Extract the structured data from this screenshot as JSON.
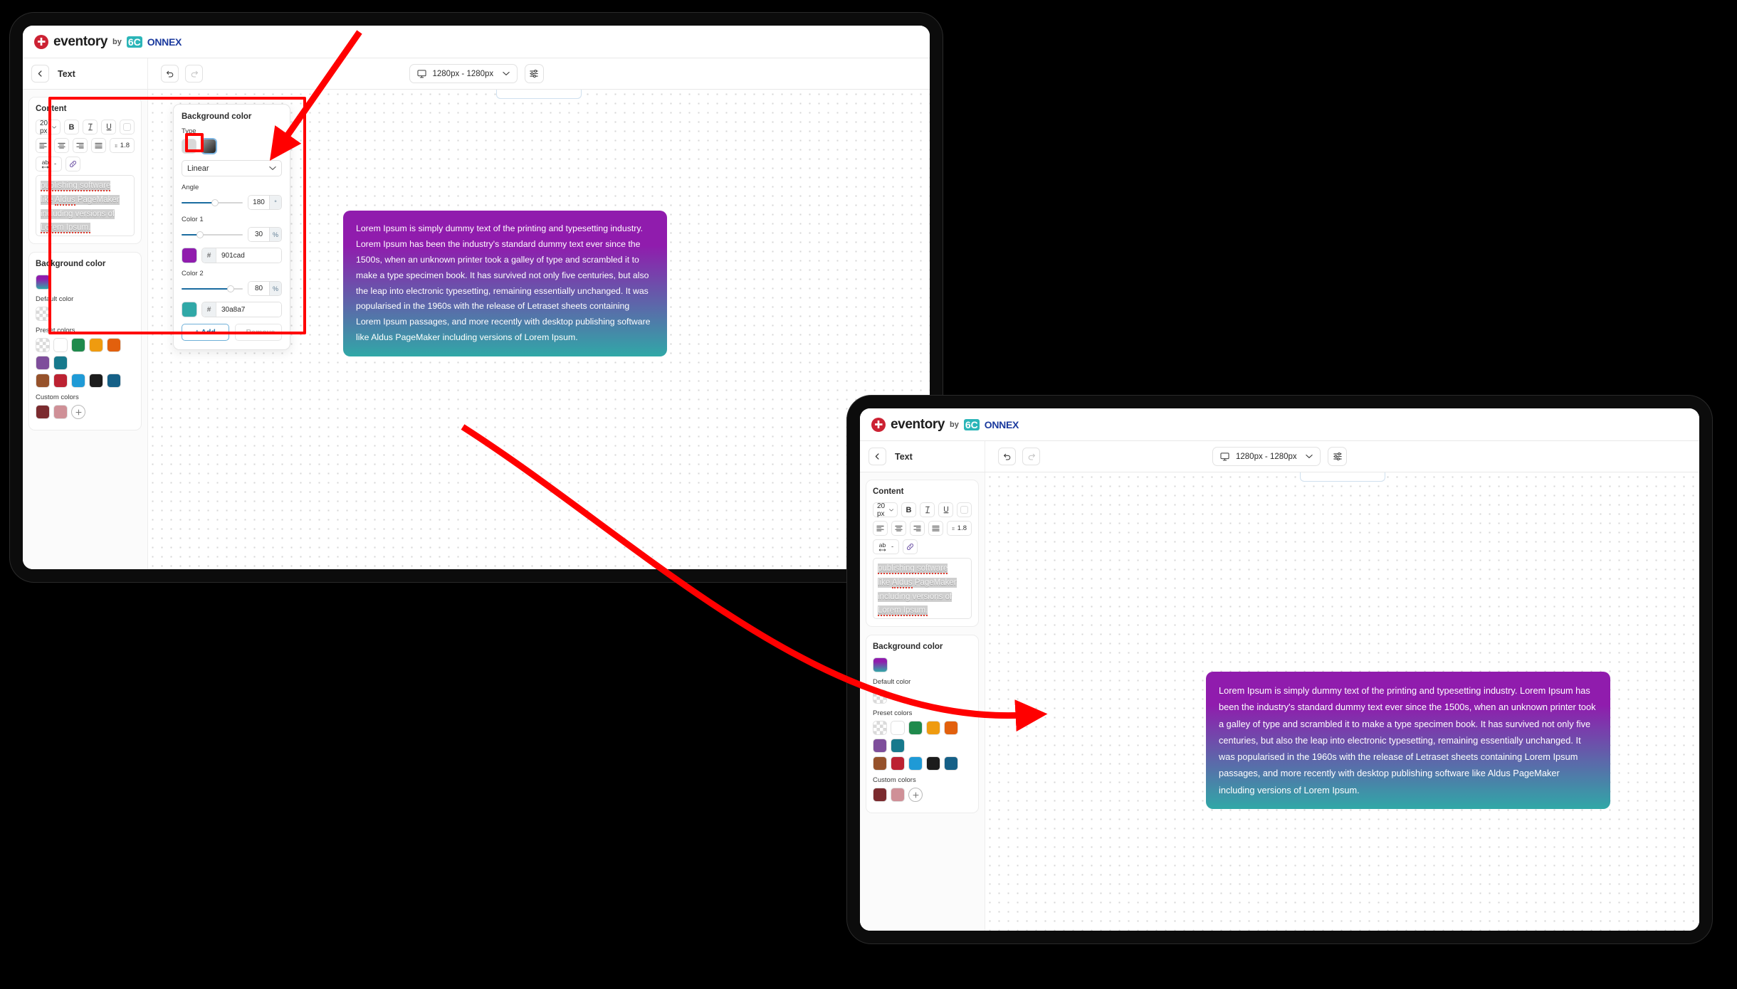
{
  "brand": {
    "name": "eventory",
    "by": "by",
    "partner_prefix": "6C",
    "partner_suffix": "ONNEX",
    "mark_color": "#cc2233",
    "partner_badge_color": "#2bb5b8",
    "partner_text_color": "#1b3a9e"
  },
  "toolbar": {
    "back_label": "‹",
    "title": "Text",
    "undo_icon": "undo-icon",
    "redo_icon": "redo-icon",
    "device_icon": "monitor-icon",
    "device_value": "1280px - 1280px",
    "chevron": "⌄",
    "settings_icon": "sliders-icon"
  },
  "content_card": {
    "title": "Content",
    "font_size": "20 px",
    "bold_label": "B",
    "italic_label": "I",
    "underline_label": "U",
    "color_label": "text-color-swatch",
    "align_left": "align-left-icon",
    "align_center": "align-center-icon",
    "align_right": "align-right-icon",
    "align_justify": "align-justify-icon",
    "line_height_icon": "line-height-icon",
    "line_height_value": "1.8",
    "letter_spacing_icon": "ab",
    "letter_spacing_value": "-",
    "link_icon": "link-icon",
    "preview_lines": [
      "publishing software",
      "like Aldus PageMaker",
      "including versions of",
      "Lorem Ipsum."
    ]
  },
  "background_card": {
    "title": "Background color",
    "current_gradient": "linear-gradient(#901cad, #30a8a7)",
    "default_label": "Default color",
    "default_value": "transparent",
    "preset_label": "Preset colors",
    "preset_colors": [
      "transparent",
      "#ffffff",
      "#1f8a4c",
      "#ef9b0f",
      "#e2600d",
      "#7e4e9b",
      "#17798c",
      "#96522b",
      "#bc2232",
      "#1f9ad6",
      "#1c1c1c",
      "#156087"
    ],
    "custom_label": "Custom colors",
    "custom_colors": [
      "#7b2b2f",
      "#cf9097"
    ],
    "add_custom_label": "+"
  },
  "gradient_popup": {
    "title": "Background color",
    "type_label": "Type",
    "type_solid": "solid-swatch",
    "type_gradient": "gradient-swatch",
    "mode_value": "Linear",
    "angle_label": "Angle",
    "angle_value": "180",
    "angle_unit": "°",
    "angle_percent": 55,
    "color1_label": "Color 1",
    "color1_stop": "30",
    "color1_unit": "%",
    "color1_hash": "#",
    "color1_hex": "901cad",
    "color2_label": "Color 2",
    "color2_stop": "80",
    "color2_unit": "%",
    "color2_hash": "#",
    "color2_hex": "30a8a7",
    "add_label": "+ Add",
    "remove_label": "- Remove"
  },
  "canvas": {
    "lorem_text": "Lorem Ipsum is simply dummy text of the printing and typesetting industry. Lorem Ipsum has been the industry's standard dummy text ever since the 1500s, when an unknown printer took a galley of type and scrambled it to make a type specimen book. It has survived not only five centuries, but also the leap into electronic typesetting, remaining essentially unchanged. It was popularised in the 1960s with the release of Letraset sheets containing Lorem Ipsum passages, and more recently with desktop publishing software like Aldus PageMaker including versions of Lorem Ipsum."
  },
  "annotations": {
    "highlight_color": "#ff0000",
    "arrow_top_name": "arrow-to-gradient-type",
    "arrow_bottom_name": "arrow-to-result-preview"
  }
}
